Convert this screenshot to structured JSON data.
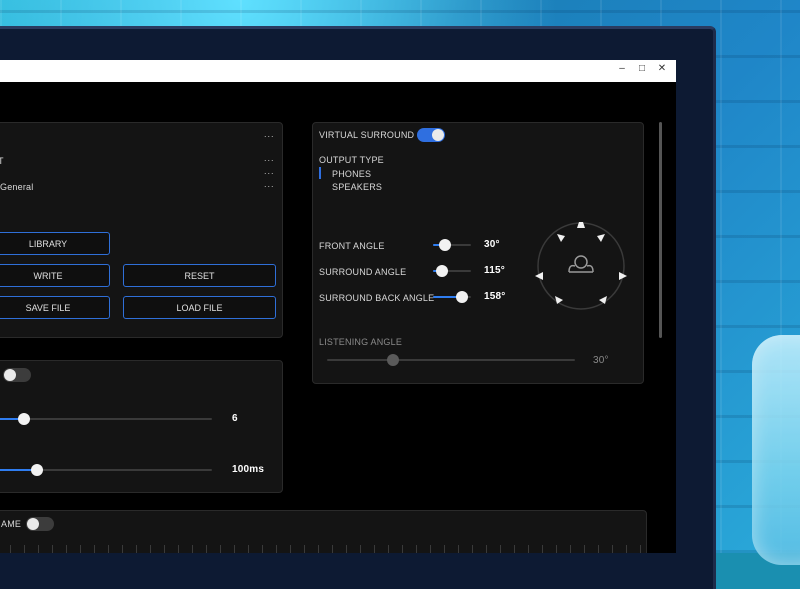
{
  "window": {
    "controls": [
      "–",
      "□",
      "✕"
    ]
  },
  "preset_panel": {
    "rows": [
      {
        "label": "",
        "menu": "..."
      },
      {
        "label": "T",
        "menu": "..."
      },
      {
        "label": "",
        "menu": "..."
      },
      {
        "label": "General",
        "menu": "..."
      }
    ],
    "buttons": {
      "library": "LIBRARY",
      "write": "WRITE",
      "reset": "RESET",
      "save_file": "SAVE FILE",
      "load_file": "LOAD FILE"
    }
  },
  "lower_panel": {
    "toggle_on": false,
    "slider1": {
      "value": "6",
      "fraction": 0.1
    },
    "slider2": {
      "value": "100ms",
      "fraction": 0.17
    }
  },
  "bottom_panel": {
    "label": "AME",
    "toggle_on": false
  },
  "surround_panel": {
    "virtual_surround_label": "VIRTUAL SURROUND",
    "virtual_surround_on": true,
    "output_type_label": "OUTPUT TYPE",
    "output_options": [
      "PHONES",
      "SPEAKERS"
    ],
    "selected_output": "PHONES",
    "front_angle": {
      "label": "FRONT ANGLE",
      "value": "30°",
      "fraction": 0.35
    },
    "surround_angle": {
      "label": "SURROUND ANGLE",
      "value": "115°",
      "fraction": 0.25
    },
    "surround_back_angle": {
      "label": "SURROUND BACK ANGLE",
      "value": "158°",
      "fraction": 0.75
    },
    "listening_angle": {
      "label": "LISTENING ANGLE",
      "value": "30°",
      "fraction": 0.27
    }
  },
  "colors": {
    "accent": "#2f6fe0",
    "panel": "#141414",
    "screen": "#000000"
  }
}
